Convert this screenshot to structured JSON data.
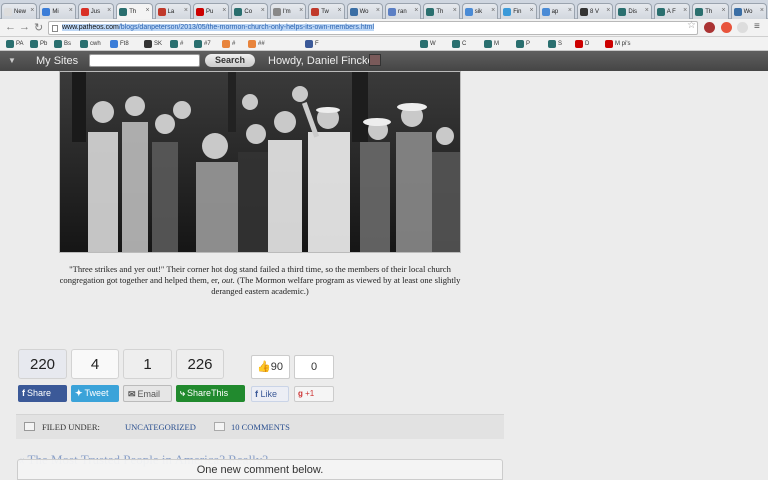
{
  "browser": {
    "tabs": [
      {
        "label": "New",
        "color": "#dddddd"
      },
      {
        "label": "Mi",
        "color": "#3b7dd8"
      },
      {
        "label": "Jus",
        "color": "#d93025"
      },
      {
        "label": "Th",
        "color": "#2a6f6f"
      },
      {
        "label": "La",
        "color": "#c0392b"
      },
      {
        "label": "Pu",
        "color": "#cc0000"
      },
      {
        "label": "Co",
        "color": "#2a6f6f"
      },
      {
        "label": "I'm",
        "color": "#888888"
      },
      {
        "label": "Tw",
        "color": "#c0392b"
      },
      {
        "label": "Wo",
        "color": "#3a6ea5"
      },
      {
        "label": "ran",
        "color": "#5b7fc4"
      },
      {
        "label": "Th",
        "color": "#2a6f6f"
      },
      {
        "label": "sik",
        "color": "#4a8bd6"
      },
      {
        "label": "Fin",
        "color": "#3b9ad9"
      },
      {
        "label": "ap",
        "color": "#4a8bd6"
      },
      {
        "label": "8 V",
        "color": "#333333"
      },
      {
        "label": "Dis",
        "color": "#2a6f6f"
      },
      {
        "label": "A F",
        "color": "#2a6f6f"
      },
      {
        "label": "Th",
        "color": "#2a6f6f"
      },
      {
        "label": "Wo",
        "color": "#3a6ea5"
      }
    ],
    "url_domain": "www.patheos.com",
    "url_path": "/blogs/danpeterson/2013/05/the-mormon-church-only-helps-its-own-members.html",
    "bookmarks": [
      "PA",
      "Pb",
      "Bs",
      "cwh",
      "Ft8",
      "SK",
      "#",
      "#7",
      "#",
      "##",
      "F",
      "W",
      "C",
      "M",
      "P",
      "S",
      "D",
      "M pi's"
    ]
  },
  "adminbar": {
    "my_sites": "My Sites",
    "search_button": "Search",
    "howdy": "Howdy, Daniel Fincke"
  },
  "caption": {
    "part1": "\"Three strikes and yer out!\" Their corner hot dog stand failed a third time, so the members of their local church congregation got together and helped them, er, ",
    "emph": "out.",
    "part2": " (The Mormon welfare program as viewed by at least one slightly deranged eastern academic.)"
  },
  "share": {
    "counts": [
      "220",
      "4",
      "1",
      "226"
    ],
    "facebook_label": "Share",
    "twitter_label": "Tweet",
    "email_label": "Email",
    "sharethis_label": "ShareThis",
    "fb_like_count": "90",
    "fb_like_label": "Like",
    "gplus_count": "0",
    "gplus_label": "+1"
  },
  "post_meta": {
    "filed_label": "FILED UNDER:",
    "category": "UNCATEGORIZED",
    "comments": "10 COMMENTS"
  },
  "next_post": "« The Most Trusted People in America? Really?",
  "new_comment_notice": "One new comment below."
}
